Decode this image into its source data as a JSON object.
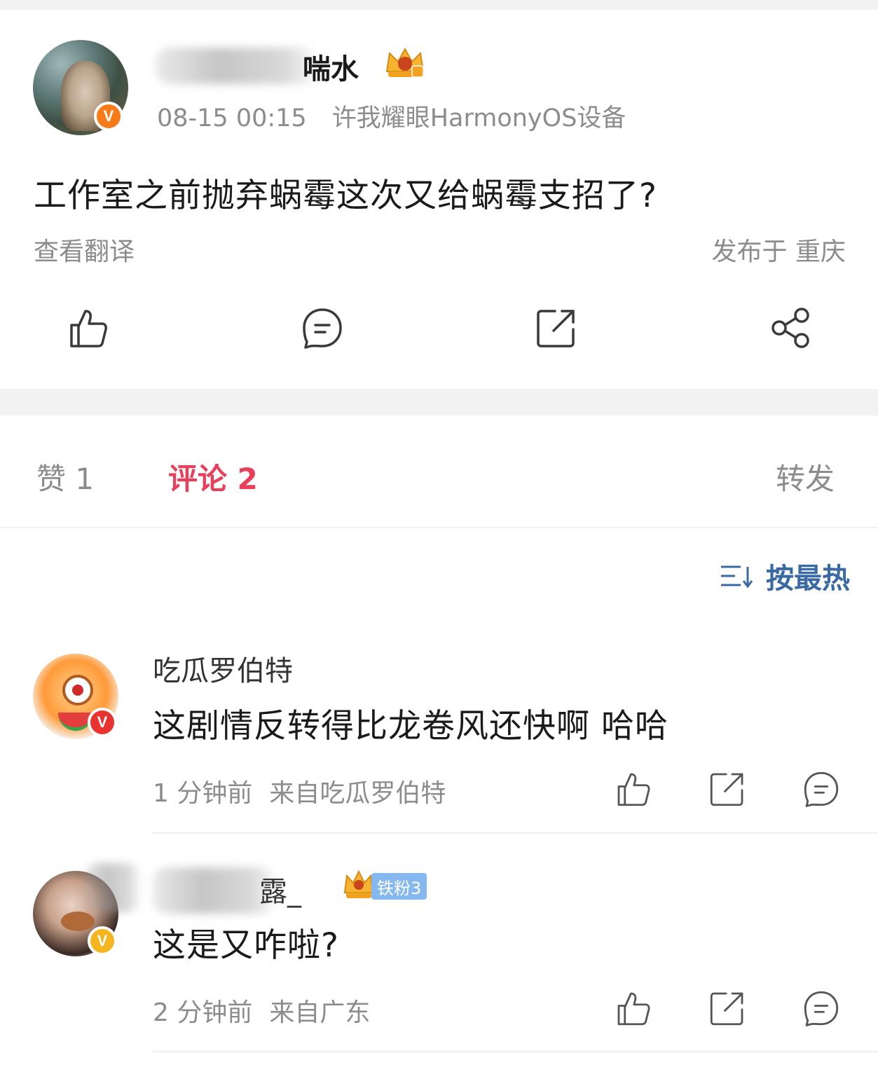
{
  "post": {
    "author_name_visible": "喘水",
    "timestamp": "08-15 00:15",
    "device": "许我耀眼HarmonyOS设备",
    "text": "工作室之前抛弃蜗霉这次又给蜗霉支招了?",
    "translate_label": "查看翻译",
    "location": "发布于 重庆",
    "verified_mark": "V"
  },
  "tabs": {
    "likes": "赞 1",
    "comments": "评论 2",
    "reposts": "转发"
  },
  "sort": {
    "label": "按最热"
  },
  "comments": [
    {
      "name": "吃瓜罗伯特",
      "text": "这剧情反转得比龙卷风还快啊 哈哈",
      "time": "1 分钟前",
      "source": "来自吃瓜罗伯特",
      "verified_mark": "V"
    },
    {
      "name_visible": "露_",
      "fan_badge": "铁粉3",
      "text": "这是又咋啦?",
      "time": "2 分钟前",
      "source": "来自广东",
      "verified_mark": "V"
    }
  ],
  "colors": {
    "accent_tab": "#e8405a",
    "sort_blue": "#3a6aa3",
    "meta_gray": "#8c8c8c",
    "fan_badge_bg": "#86b8f0"
  },
  "icons": {
    "post_actions": [
      "thumbs-up-icon",
      "comment-icon",
      "repost-icon",
      "share-icon"
    ],
    "comment_actions": [
      "thumbs-up-icon",
      "repost-icon",
      "comment-icon"
    ],
    "sort": "sort-icon"
  }
}
